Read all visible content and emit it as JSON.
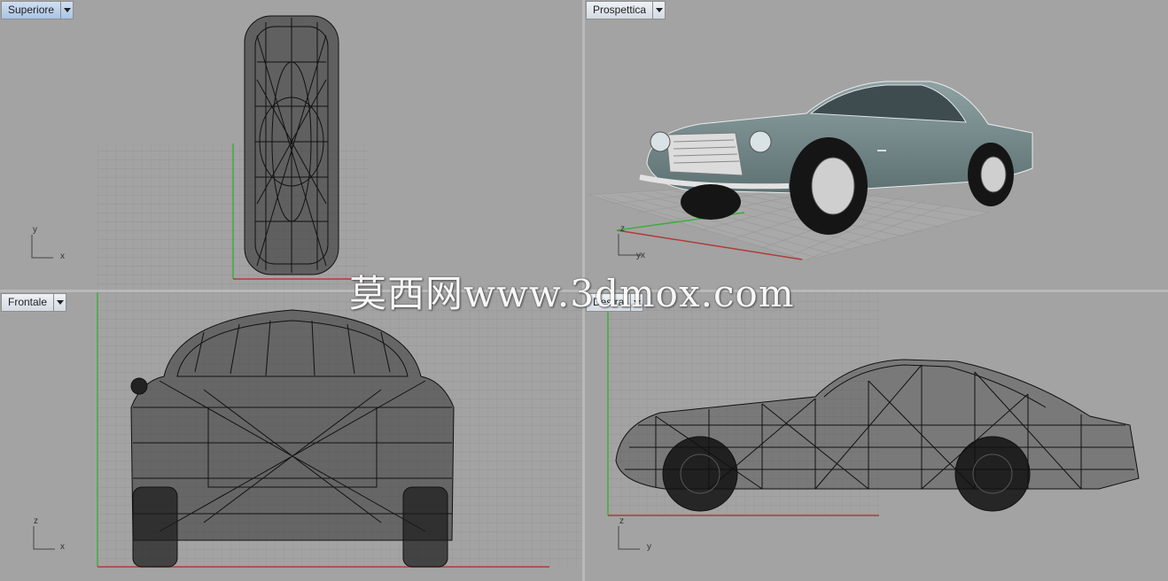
{
  "viewports": {
    "top": {
      "label": "Superiore",
      "axis_v": "y",
      "axis_h": "x"
    },
    "perspective": {
      "label": "Prospettica",
      "axis_v": "z",
      "axis_h": "yx"
    },
    "front": {
      "label": "Frontale",
      "axis_v": "z",
      "axis_h": "x"
    },
    "right": {
      "label": "Destra",
      "axis_v": "z",
      "axis_h": "y"
    }
  },
  "watermark": "莫西网www.3dmox.com",
  "icons": {
    "viewport_menu": "triangle-down-icon"
  },
  "colors": {
    "viewport_bg": "#a3a3a3",
    "grid_line": "#8f8f8f",
    "x_axis": "#b33a3a",
    "y_axis": "#3cae3c",
    "car_body": "#6f8587"
  }
}
